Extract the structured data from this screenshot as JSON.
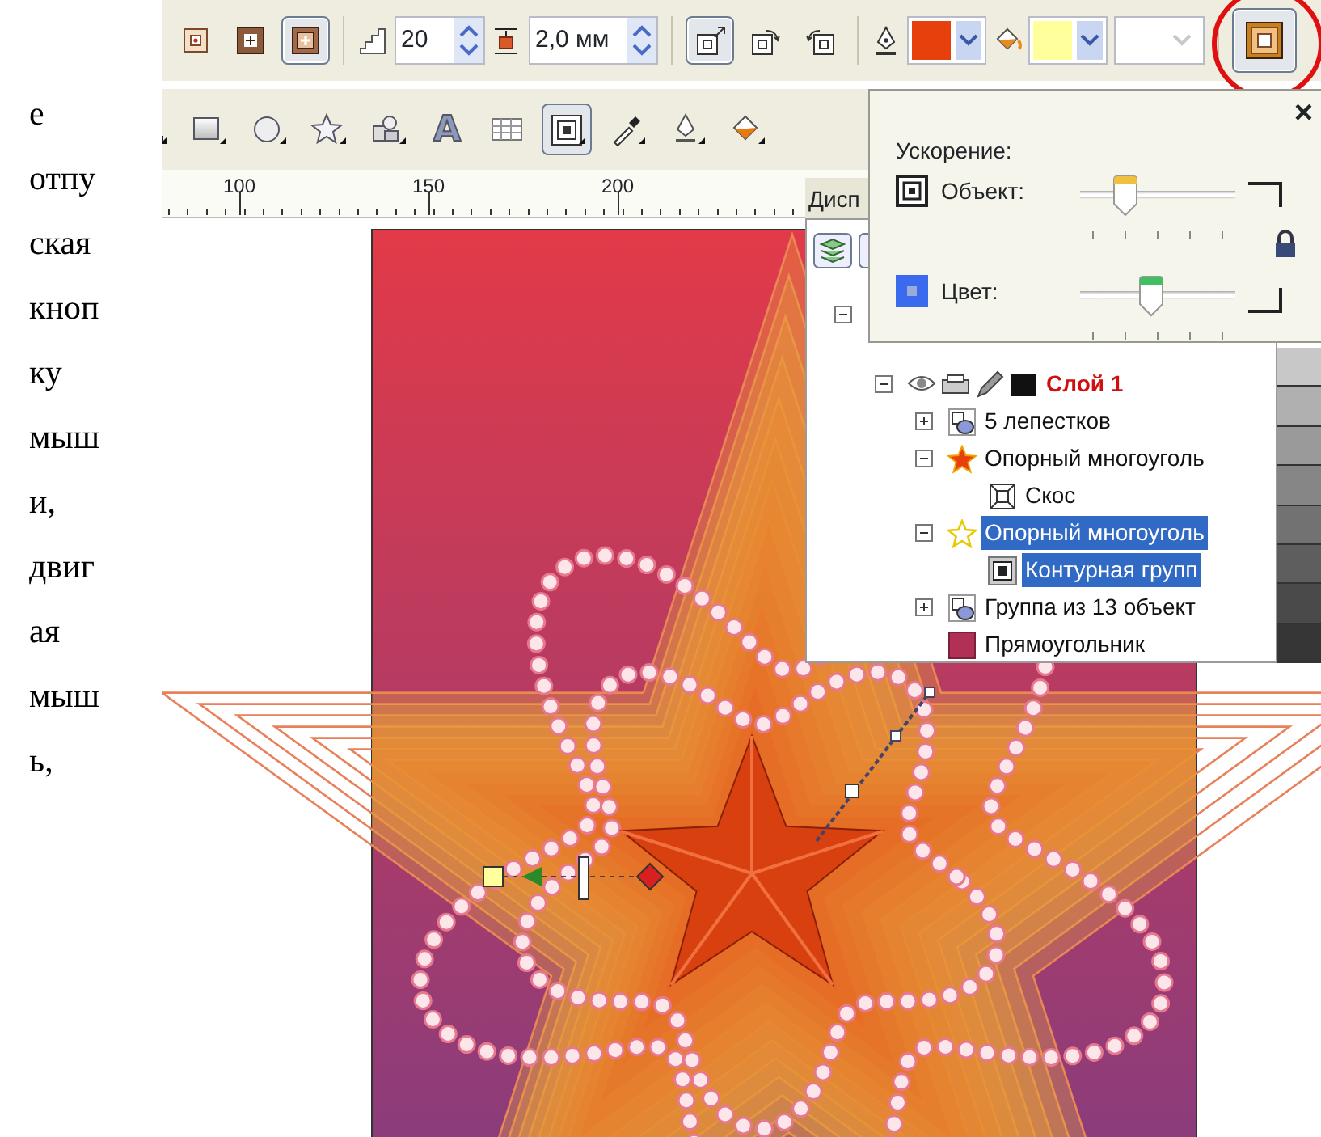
{
  "text_column": {
    "lines": [
      "е",
      "отпу",
      "ская",
      "кноп",
      "ку",
      "мыш",
      "и,",
      "двиг",
      "ая",
      "мыш",
      "ь,"
    ]
  },
  "property_bar": {
    "items": [
      {
        "kind": "toggle",
        "selected": false
      },
      {
        "kind": "toggle",
        "selected": false
      },
      {
        "kind": "toggle",
        "selected": true
      },
      {
        "kind": "spinner",
        "value": "20"
      },
      {
        "kind": "spinner",
        "value": "2,0 мм"
      },
      {
        "kind": "toggle",
        "selected": true
      },
      {
        "kind": "toggle",
        "selected": false
      },
      {
        "kind": "toggle",
        "selected": false
      },
      {
        "kind": "color",
        "color": "#e8400c",
        "disabled": false
      },
      {
        "kind": "color",
        "color": "#ffff9c",
        "disabled": false
      },
      {
        "kind": "color",
        "disabled": true
      },
      {
        "kind": "toggle",
        "selected": true,
        "circled": true
      }
    ]
  },
  "toolbox": {
    "tools": [
      {
        "selected": false
      },
      {
        "selected": false
      },
      {
        "selected": false
      },
      {
        "selected": false
      },
      {
        "selected": false
      },
      {
        "selected": false,
        "glyph": "A"
      },
      {
        "selected": false
      },
      {
        "selected": true
      },
      {
        "selected": false
      },
      {
        "selected": false
      },
      {
        "selected": false
      }
    ]
  },
  "ruler": {
    "labels": [
      "100",
      "150",
      "200"
    ]
  },
  "acceleration_popup": {
    "title": "Ускорение:",
    "close": "×",
    "linked": true,
    "sliders": [
      {
        "label": "Объект:",
        "level": 0.25
      },
      {
        "label": "Цвет:",
        "level": 0.45
      }
    ]
  },
  "object_manager": {
    "tab": "Дисп",
    "tree": [
      {
        "expanded": true,
        "children": [
          {
            "kind": "layer",
            "label": "Слой 1",
            "selected": false,
            "expanded": true,
            "children": [
              {
                "kind": "group",
                "label": "5 лепестков",
                "selected": false,
                "expanded": false
              },
              {
                "kind": "star",
                "label": "Опорный многоуголь",
                "selected": false,
                "expanded": true,
                "children": [
                  {
                    "kind": "bevel",
                    "label": "Скос",
                    "selected": false
                  }
                ]
              },
              {
                "kind": "star-outline",
                "label": "Опорный многоуголь",
                "selected": true,
                "expanded": true,
                "children": [
                  {
                    "kind": "contour",
                    "label": "Контурная групп",
                    "selected": true
                  }
                ]
              },
              {
                "kind": "group",
                "label": "Группа из 13 объект",
                "selected": false,
                "expanded": false
              },
              {
                "kind": "rectangle",
                "label": "Прямоугольник",
                "selected": false
              }
            ]
          }
        ]
      }
    ]
  }
}
